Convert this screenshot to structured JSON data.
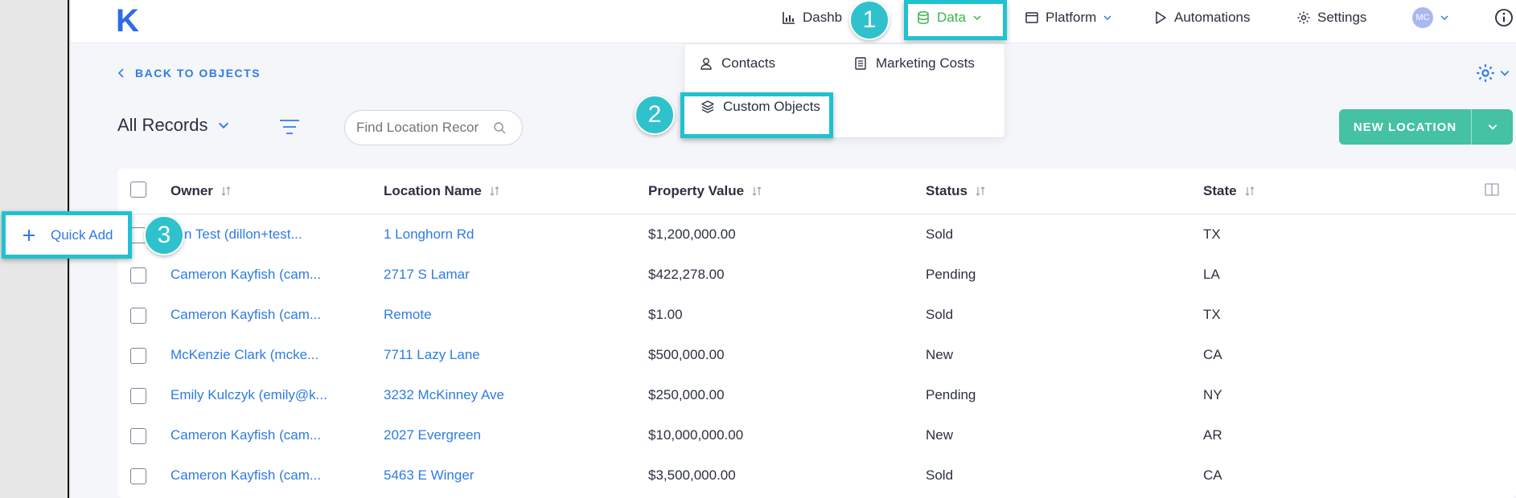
{
  "app": {
    "logo": "K"
  },
  "nav": {
    "dashboard": "Dashb",
    "data": "Data",
    "platform": "Platform",
    "automations": "Automations",
    "settings": "Settings",
    "avatar": "MC"
  },
  "dropdown": {
    "contacts": "Contacts",
    "marketing_costs": "Marketing Costs",
    "custom_objects": "Custom Objects"
  },
  "callouts": {
    "step1": "1",
    "step2": "2",
    "step3": "3"
  },
  "page": {
    "back_label": "BACK TO OBJECTS",
    "view_label": "All Records",
    "search_placeholder": "Find Location Recor",
    "new_button": "NEW LOCATION",
    "quick_add": "Quick Add"
  },
  "table": {
    "columns": [
      "Owner",
      "Location Name",
      "Property Value",
      "Status",
      "State"
    ],
    "rows": [
      {
        "owner": "llon Test (dillon+test...",
        "location": "1 Longhorn Rd",
        "value": "$1,200,000.00",
        "status": "Sold",
        "state": "TX"
      },
      {
        "owner": "Cameron Kayfish (cam...",
        "location": "2717 S Lamar",
        "value": "$422,278.00",
        "status": "Pending",
        "state": "LA"
      },
      {
        "owner": "Cameron Kayfish (cam...",
        "location": "Remote",
        "value": "$1.00",
        "status": "Sold",
        "state": "TX"
      },
      {
        "owner": "McKenzie Clark (mcke...",
        "location": "7711 Lazy Lane",
        "value": "$500,000.00",
        "status": "New",
        "state": "CA"
      },
      {
        "owner": "Emily Kulczyk (emily@k...",
        "location": "3232 McKinney Ave",
        "value": "$250,000.00",
        "status": "Pending",
        "state": "NY"
      },
      {
        "owner": "Cameron Kayfish (cam...",
        "location": "2027 Evergreen",
        "value": "$10,000,000.00",
        "status": "New",
        "state": "AR"
      },
      {
        "owner": "Cameron Kayfish (cam...",
        "location": "5463 E Winger",
        "value": "$3,500,000.00",
        "status": "Sold",
        "state": "CA"
      }
    ]
  },
  "colors": {
    "brand": "#2e6be6",
    "link": "#2e7be6",
    "active_nav": "#3bb44a",
    "callout": "#1fc2cf",
    "primary_button": "#44c2a3"
  }
}
